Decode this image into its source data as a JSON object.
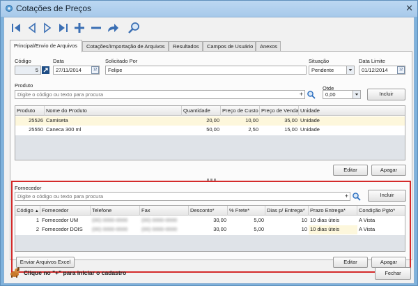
{
  "window": {
    "title": "Cotações de Preços",
    "close_glyph": "✕"
  },
  "toolbar": {
    "icons": [
      "first-record-icon",
      "previous-record-icon",
      "next-record-icon",
      "last-record-icon",
      "add-icon",
      "remove-icon",
      "redo-icon",
      "search-icon"
    ]
  },
  "tabs": [
    {
      "label": "Principal/Envio de Arquivos",
      "active": true
    },
    {
      "label": "Cotações/Importação de Arquivos"
    },
    {
      "label": "Resultados"
    },
    {
      "label": "Campos de Usuário"
    },
    {
      "label": "Anexos"
    }
  ],
  "header_fields": {
    "codigo": {
      "label": "Código",
      "value": "5"
    },
    "data": {
      "label": "Data",
      "value": "27/11/2014"
    },
    "solicitado_por": {
      "label": "Solicitado Por",
      "value": "Felipe"
    },
    "situacao": {
      "label": "Situação",
      "value": "Pendente"
    },
    "data_limite": {
      "label": "Data Limite",
      "value": "01/12/2014"
    },
    "calendar_glyph": "12"
  },
  "produto": {
    "label": "Produto",
    "placeholder": "Digite o código ou texto para procura",
    "qtde_label": "Qtde",
    "qtde_value": "0,00",
    "add_button": "Incluir",
    "plus_glyph": "+"
  },
  "produtos_grid": {
    "columns": [
      "Produto",
      "Nome do Produto",
      "Quantidade",
      "Preço de Custo",
      "Preço de Venda",
      "Unidade"
    ],
    "rows": [
      [
        "25526",
        "Camiseta",
        "20,00",
        "10,00",
        "35,00",
        "Unidade"
      ],
      [
        "25550",
        "Caneca 300 ml",
        "50,00",
        "2,50",
        "15,00",
        "Unidade"
      ]
    ],
    "edit_button": "Editar",
    "delete_button": "Apagar"
  },
  "fornecedor": {
    "label": "Fornecedor",
    "placeholder": "Digite o código ou texto para procura",
    "add_button": "Incluir",
    "plus_glyph": "+"
  },
  "fornecedores_grid": {
    "columns": [
      "Código",
      "Fornecedor",
      "Telefone",
      "Fax",
      "Desconto*",
      "% Frete*",
      "Dias p/ Entrega*",
      "Prazo Entrega*",
      "Condição Pgto*"
    ],
    "sort_glyph": "▲",
    "rows": [
      [
        "1",
        "Fornecedor UM",
        "(00) 0000-0000",
        "(00) 0000-0000",
        "30,00",
        "5,00",
        "10",
        "10 dias úteis",
        "A Vista"
      ],
      [
        "2",
        "Fornecedor DOIS",
        "(00) 0000-0000",
        "(00) 0000-0000",
        "30,00",
        "5,00",
        "10",
        "10 dias úteis",
        "A Vista"
      ]
    ],
    "send_button": "Enviar Arquivos Excel",
    "edit_button": "Editar",
    "delete_button": "Apagar"
  },
  "status": {
    "hint": "Clique no \"+\" para iniciar o cadastro",
    "close_button": "Fechar"
  },
  "colors": {
    "highlight_border": "#d42a2a",
    "accent": "#2a6dbf"
  }
}
